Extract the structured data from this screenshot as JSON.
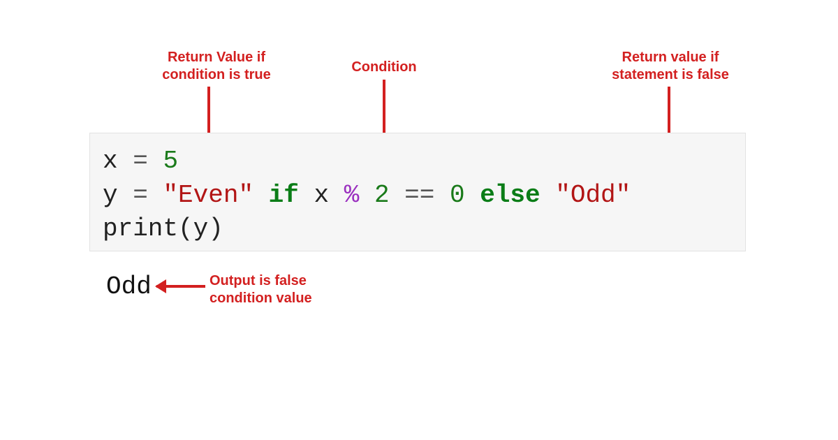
{
  "annotations": {
    "true_value": "Return Value if\ncondition is true",
    "condition": "Condition",
    "false_value": "Return value if\nstatement is false",
    "output_note": "Output is false\ncondition value"
  },
  "code": {
    "line1": {
      "var": "x",
      "assign": "=",
      "val": "5"
    },
    "line2": {
      "var": "y",
      "assign": "=",
      "str_true": "\"Even\"",
      "kw_if": "if",
      "ident": "x",
      "op_mod": "%",
      "two": "2",
      "op_eq": "==",
      "zero": "0",
      "kw_else": "else",
      "str_false": "\"Odd\""
    },
    "line3": {
      "call": "print(y)"
    }
  },
  "output_text": "Odd"
}
